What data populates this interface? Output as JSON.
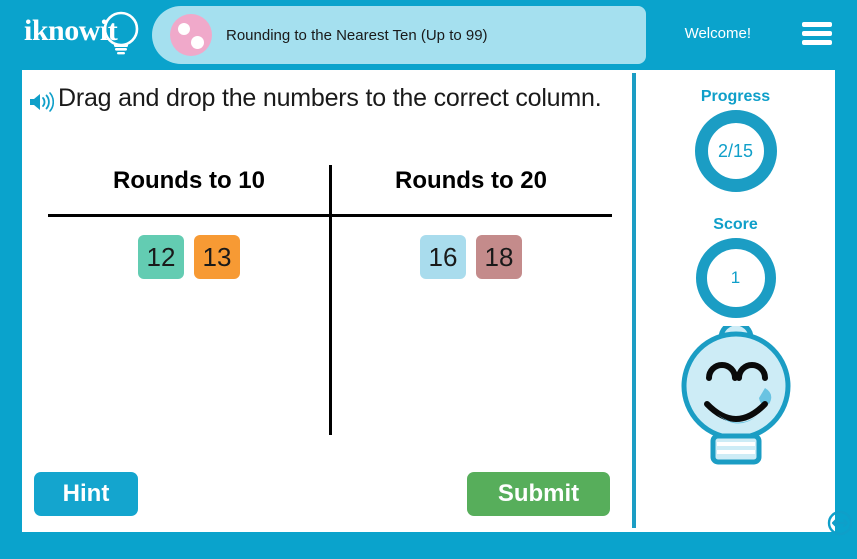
{
  "header": {
    "logo_text": "iknowit",
    "logo_icon": "lightbulb-icon",
    "title": "Rounding to the Nearest Ten (Up to 99)",
    "title_icon": "pink-dots-circle-icon",
    "welcome_label": "Welcome!",
    "menu_icon": "hamburger-menu-icon",
    "bg_color": "#0aa3cc",
    "pill_color": "#a5e0ef",
    "dot_color": "#f0a9ca"
  },
  "main": {
    "audio_icon": "speaker-icon",
    "instruction": "Drag and drop the numbers to the correct column.",
    "columns": [
      {
        "header": "Rounds to 10",
        "tiles": [
          {
            "value": "12",
            "color": "#63ccb2"
          },
          {
            "value": "13",
            "color": "#f79a34"
          }
        ]
      },
      {
        "header": "Rounds to 20",
        "tiles": [
          {
            "value": "16",
            "color": "#a9dced"
          },
          {
            "value": "18",
            "color": "#c48b8b"
          }
        ]
      }
    ],
    "hint_label": "Hint",
    "hint_color": "#14a5ce",
    "submit_label": "Submit",
    "submit_color": "#57ae5b"
  },
  "sidebar": {
    "progress_label": "Progress",
    "progress_value": "2/15",
    "score_label": "Score",
    "score_value": "1",
    "mascot_icon": "smiling-lightbulb-mascot-icon",
    "accent_color": "#1b9dc4",
    "resize_icon": "resize-horizontal-icon"
  }
}
